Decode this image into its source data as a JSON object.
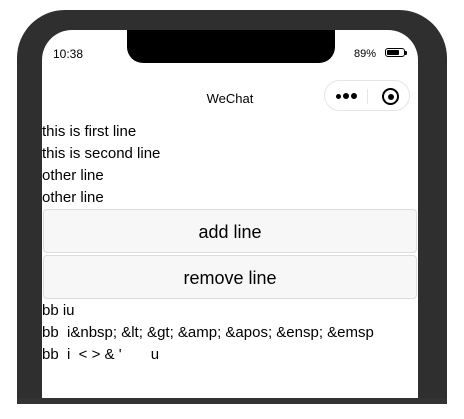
{
  "status_bar": {
    "time": "10:38",
    "battery_percent": "89%",
    "battery_level": 0.89
  },
  "nav": {
    "title": "WeChat",
    "more_icon": "more-dots-icon",
    "close_icon": "target-close-icon"
  },
  "lines": [
    "this is first line",
    "this is second line",
    "other line",
    "other line"
  ],
  "buttons": {
    "add_label": "add line",
    "remove_label": "remove line"
  },
  "text_rows": [
    "bb iu",
    "bb  i&nbsp; &lt; &gt; &amp; &apos; &ensp; &emsp",
    "bb  i  < > & '       u"
  ]
}
